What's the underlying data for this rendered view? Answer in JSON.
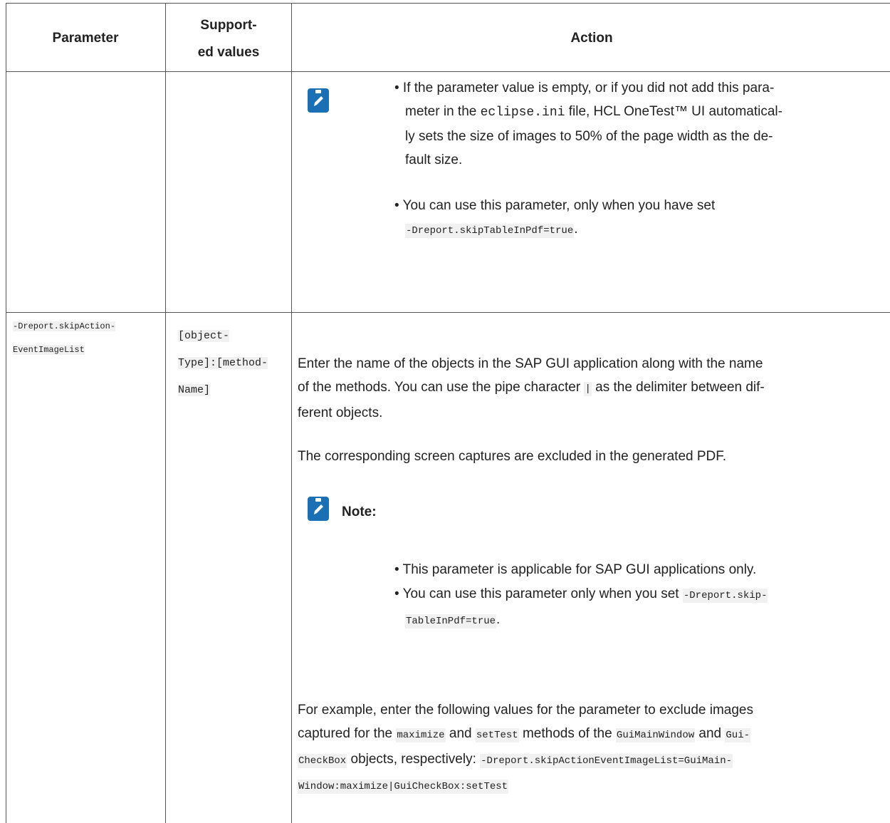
{
  "table": {
    "headers": [
      "Parameter",
      "Support-",
      "ed values",
      "Action"
    ],
    "row1": {
      "bullets": [
        [
          "• If the parameter value is empty, or if you did not add this para-",
          "meter in the ",
          "eclipse.ini",
          " file, HCL OneTest™ UI automatical-",
          "ly sets the size of images to 50% of the page width as the de-",
          "fault size."
        ],
        [
          "• You can use this parameter, only when you have set",
          "-Dreport.skipTableInPdf=true",
          "."
        ]
      ],
      "note_icon": "edit-pencil-icon"
    },
    "row2": {
      "parameter": [
        "-Dreport.skipAction-",
        "EventImageList"
      ],
      "supported_values": [
        "[object-",
        "Type]:[method-",
        "Name]"
      ],
      "action_p1": [
        "Enter the name of the objects in the SAP GUI application along with the name",
        "of the methods. You can use the pipe character ",
        "|",
        " as the delimiter between dif-",
        "ferent objects."
      ],
      "action_p2": "The corresponding screen captures are excluded in the generated PDF.",
      "note_label": "Note:",
      "note_icon": "edit-pencil-icon",
      "note_bullets": [
        [
          "• This parameter is applicable for SAP GUI applications only."
        ],
        [
          "• You can use this parameter only when you set ",
          "-Dreport.skip-",
          "TableInPdf=true",
          "."
        ]
      ],
      "example": [
        "For example, enter the following values for the parameter to exclude images",
        "captured for the ",
        "maximize",
        " and ",
        "setTest",
        " methods of the ",
        "GuiMainWindow",
        " and ",
        "Gui-",
        "CheckBox",
        " objects, respectively: ",
        "-Dreport.skipActionEventImageList=GuiMain-",
        "Window:maximize|GuiCheckBox:setTest"
      ]
    }
  },
  "colors": {
    "icon": "#1a6fb5",
    "border": "#555555",
    "code_bg": "#f1f1f1"
  }
}
